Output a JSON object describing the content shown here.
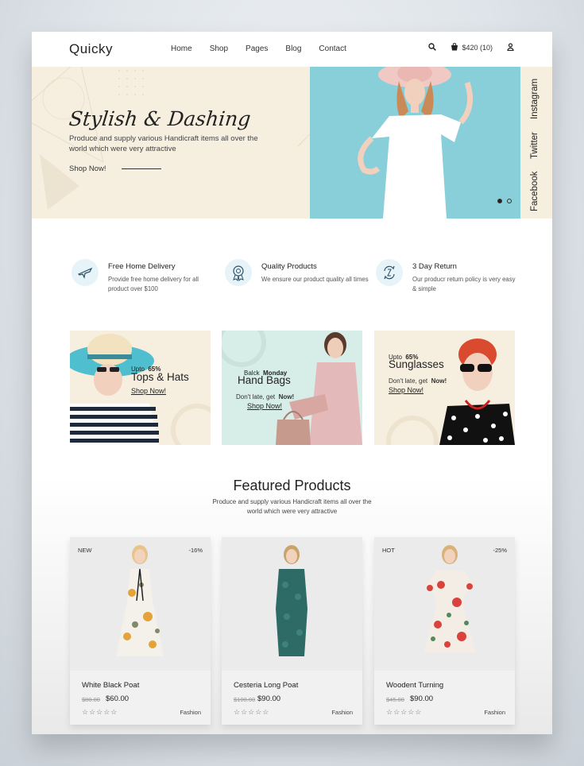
{
  "header": {
    "logo": "Quicky",
    "nav": [
      "Home",
      "Shop",
      "Pages",
      "Blog",
      "Contact"
    ],
    "cart_label": "$420 (10)"
  },
  "hero": {
    "title": "Stylish & Dashing",
    "subtitle": "Produce and supply various Handicraft items all over the world which were very attractive",
    "cta": "Shop Now!",
    "social": [
      "Instagram",
      "Twitter",
      "Facebook"
    ],
    "slides": 2,
    "active_slide": 1
  },
  "features": [
    {
      "icon": "airplane-icon",
      "title": "Free Home Delivery",
      "desc": "Provide free home delivery for all product over $100"
    },
    {
      "icon": "award-badge-icon",
      "title": "Quality Products",
      "desc": "We ensure our product quality all times"
    },
    {
      "icon": "return-arrows-icon",
      "title": "3 Day Return",
      "desc": "Our producr return policy is very easy & simple"
    }
  ],
  "promos": [
    {
      "pre": "Upto",
      "pre_bold": "65%",
      "title": "Tops & Hats",
      "note": "",
      "link": "Shop Now!",
      "bg": "#f6efe0"
    },
    {
      "pre": "Balck",
      "pre_bold": "Monday",
      "title": "Hand Bags",
      "note": "Don't late, get",
      "note_bold": "Now!",
      "link": "Shop Now!",
      "bg": "#d7ede8"
    },
    {
      "pre": "Upto",
      "pre_bold": "65%",
      "title": "Sunglasses",
      "note": "Don't late, get",
      "note_bold": "Now!",
      "link": "Shop Now!",
      "bg": "#f6efe0"
    }
  ],
  "featured": {
    "title": "Featured Products",
    "subtitle": "Produce and supply various Handicraft items all over the world which were very attractive",
    "products": [
      {
        "tag": "NEW",
        "discount": "-16%",
        "name": "White Black Poat",
        "old_price": "$80.00",
        "price": "$60.00",
        "category": "Fashion",
        "stars": "☆☆☆☆☆"
      },
      {
        "tag": "",
        "discount": "",
        "name": "Cesteria Long Poat",
        "old_price": "$100.00",
        "price": "$90.00",
        "category": "Fashion",
        "stars": "☆☆☆☆☆"
      },
      {
        "tag": "HOT",
        "discount": "-25%",
        "name": "Woodent Turning",
        "old_price": "$45.00",
        "price": "$90.00",
        "category": "Fashion",
        "stars": "☆☆☆☆☆"
      }
    ]
  },
  "colors": {
    "cream": "#f6efe0",
    "teal": "#88cfd9",
    "mint": "#d7ede8"
  }
}
